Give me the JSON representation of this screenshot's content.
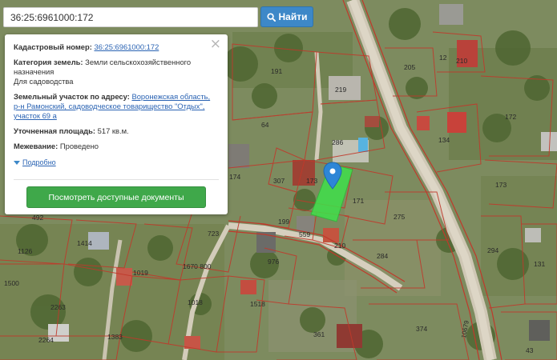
{
  "search": {
    "value": "36:25:6961000:172",
    "button_label": "Найти"
  },
  "info_panel": {
    "close_symbol": "×",
    "cadastral_label": "Кадастровый номер:",
    "cadastral_value": "36:25:6961000:172",
    "category_label": "Категория земель:",
    "category_value": "Земли сельскохозяйственного назначения",
    "category_use": "Для садоводства",
    "address_label": "Земельный участок по адресу:",
    "address_value": "Воронежская область, р-н Рамонский, садоводческое товарищество \"Отдых\", участок 69 а",
    "area_label": "Уточненная площадь:",
    "area_value": "517 кв.м.",
    "survey_label": "Межевание:",
    "survey_value": "Проведено",
    "details_link": "Подробно",
    "docs_button": "Посмотреть доступные документы"
  },
  "map": {
    "parcel_labels": [
      "191",
      "219",
      "64",
      "286",
      "307",
      "173",
      "171",
      "199",
      "559",
      "210",
      "275",
      "284",
      "205",
      "12",
      "210",
      "172",
      "134",
      "173",
      "294",
      "131",
      "174",
      "492",
      "723",
      "1414",
      "1126",
      "1019",
      "1670 800",
      "976",
      "1500",
      "1018",
      "1518",
      "2263",
      "2264",
      "1383",
      "361",
      "374",
      "43"
    ],
    "road_label": "10679",
    "colors": {
      "selected_parcel": "#3fe04a",
      "parcel_outline": "#c0392b",
      "marker": "#2d86d6",
      "road": "#d9d2c3"
    }
  },
  "icons": {
    "search": "search-icon",
    "close": "close-icon",
    "marker": "map-marker-icon",
    "expand": "caret-down-icon"
  }
}
